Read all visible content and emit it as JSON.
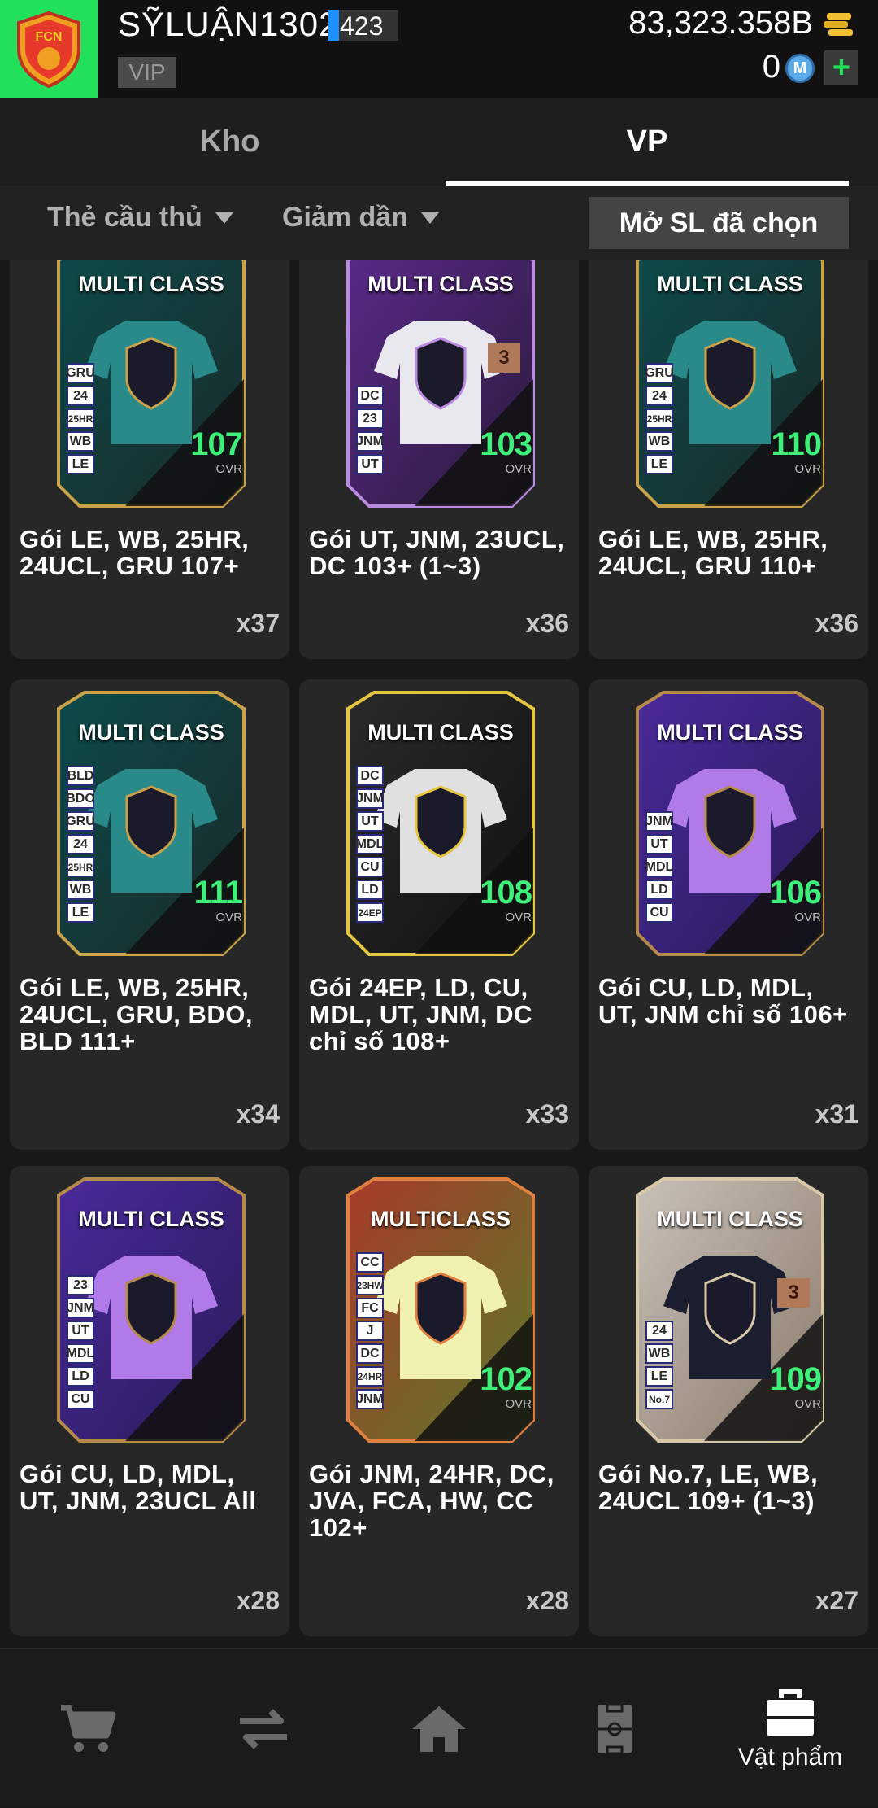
{
  "header": {
    "username": "SỸLUẬN1302",
    "level": "423",
    "level_progress": 0.15,
    "vip_label": "VIP",
    "coins": "83,323.358B",
    "mc_amount": "0",
    "mc_icon_letter": "M",
    "plus_label": "+"
  },
  "tabs": [
    {
      "label": "Kho",
      "active": false
    },
    {
      "label": "VP",
      "active": true
    }
  ],
  "filters": {
    "type_label": "Thẻ cầu thủ",
    "sort_label": "Giảm dần",
    "open_selected_label": "Mở SL đã chọn"
  },
  "items": [
    {
      "name": "Gói LE, WB, 25HR, 24UCL, GRU 107+",
      "qty": "x37",
      "card_label": "MULTI CLASS",
      "ovr": "107",
      "ovr_label": "OVR",
      "badges": [
        "GRU",
        "24",
        "25HR",
        "WB",
        "LE"
      ],
      "theme": "teal",
      "rank": ""
    },
    {
      "name": "Gói UT, JNM, 23UCL, DC 103+ (1~3)",
      "qty": "x36",
      "card_label": "MULTI CLASS",
      "ovr": "103",
      "ovr_label": "OVR",
      "badges": [
        "DC",
        "23",
        "JNM",
        "UT"
      ],
      "theme": "white",
      "rank": "3"
    },
    {
      "name": "Gói LE, WB, 25HR, 24UCL, GRU 110+",
      "qty": "x36",
      "card_label": "MULTI CLASS",
      "ovr": "110",
      "ovr_label": "OVR",
      "badges": [
        "GRU",
        "24",
        "25HR",
        "WB",
        "LE"
      ],
      "theme": "teal",
      "rank": ""
    },
    {
      "name": "Gói LE, WB, 25HR, 24UCL, GRU, BDO, BLD 111+",
      "qty": "x34",
      "card_label": "MULTI CLASS",
      "ovr": "111",
      "ovr_label": "OVR",
      "badges": [
        "BLD",
        "BDO",
        "GRU",
        "24",
        "25HR",
        "WB",
        "LE"
      ],
      "theme": "teal",
      "rank": ""
    },
    {
      "name": "Gói 24EP, LD, CU, MDL, UT, JNM, DC chỉ số 108+",
      "qty": "x33",
      "card_label": "MULTI CLASS",
      "ovr": "108",
      "ovr_label": "OVR",
      "badges": [
        "DC",
        "JNM",
        "UT",
        "MDL",
        "CU",
        "LD",
        "24EP"
      ],
      "theme": "gold",
      "rank": ""
    },
    {
      "name": "Gói CU, LD, MDL, UT, JNM chỉ số 106+",
      "qty": "x31",
      "card_label": "MULTI CLASS",
      "ovr": "106",
      "ovr_label": "OVR",
      "badges": [
        "JNM",
        "UT",
        "MDL",
        "LD",
        "CU"
      ],
      "theme": "purple",
      "rank": ""
    },
    {
      "name": "Gói CU, LD, MDL, UT, JNM, 23UCL All",
      "qty": "x28",
      "card_label": "MULTI CLASS",
      "ovr": "",
      "ovr_label": "",
      "badges": [
        "23",
        "JNM",
        "UT",
        "MDL",
        "LD",
        "CU"
      ],
      "theme": "purple",
      "rank": ""
    },
    {
      "name": "Gói JNM, 24HR, DC, JVA, FCA, HW, CC 102+",
      "qty": "x28",
      "card_label": "MULTICLASS",
      "ovr": "102",
      "ovr_label": "OVR",
      "badges": [
        "CC",
        "23HW",
        "FC",
        "J",
        "DC",
        "24HR",
        "JNM"
      ],
      "theme": "lime",
      "rank": ""
    },
    {
      "name": "Gói No.7, LE, WB, 24UCL 109+ (1~3)",
      "qty": "x27",
      "card_label": "MULTI CLASS",
      "ovr": "109",
      "ovr_label": "OVR",
      "badges": [
        "24",
        "WB",
        "LE",
        "No.7"
      ],
      "theme": "dark",
      "rank": "3"
    }
  ],
  "themes": {
    "teal": {
      "bg1": "#0d4a4a",
      "bg2": "#1a2a2a",
      "shirt": "#2a8a8a",
      "frame": "#c9a24a",
      "ovr_color": "#3ef07a"
    },
    "white": {
      "bg1": "#5a2a8a",
      "bg2": "#2a1a3a",
      "shirt": "#e8e8ee",
      "frame": "#b98adf",
      "ovr_color": "#3ef07a"
    },
    "gold": {
      "bg1": "#2a2a2a",
      "bg2": "#111111",
      "shirt": "#e0e0e0",
      "frame": "#e6c640",
      "ovr_color": "#3ef07a"
    },
    "purple": {
      "bg1": "#4a2a9a",
      "bg2": "#2a1a5a",
      "shirt": "#b07ae8",
      "frame": "#b58a4a",
      "ovr_color": "#3ef07a"
    },
    "lime": {
      "bg1": "#a83a2a",
      "bg2": "#5a7a2a",
      "shirt": "#f0f0b0",
      "frame": "#e08040",
      "ovr_color": "#3ef07a"
    },
    "dark": {
      "bg1": "#c8c0b8",
      "bg2": "#8a7a6a",
      "shirt": "#1a1e2e",
      "frame": "#d8c8a8",
      "ovr_color": "#3ef07a"
    }
  },
  "nav": [
    {
      "icon": "cart-icon",
      "label": "",
      "active": false
    },
    {
      "icon": "transfer-icon",
      "label": "",
      "active": false
    },
    {
      "icon": "home-icon",
      "label": "",
      "active": false
    },
    {
      "icon": "pitch-icon",
      "label": "",
      "active": false
    },
    {
      "icon": "bag-icon",
      "label": "Vật phẩm",
      "active": true
    }
  ],
  "colors": {
    "logo_bg": "#22e05a",
    "level_bar": "#1e90ff",
    "plus_green": "#22e05a"
  }
}
